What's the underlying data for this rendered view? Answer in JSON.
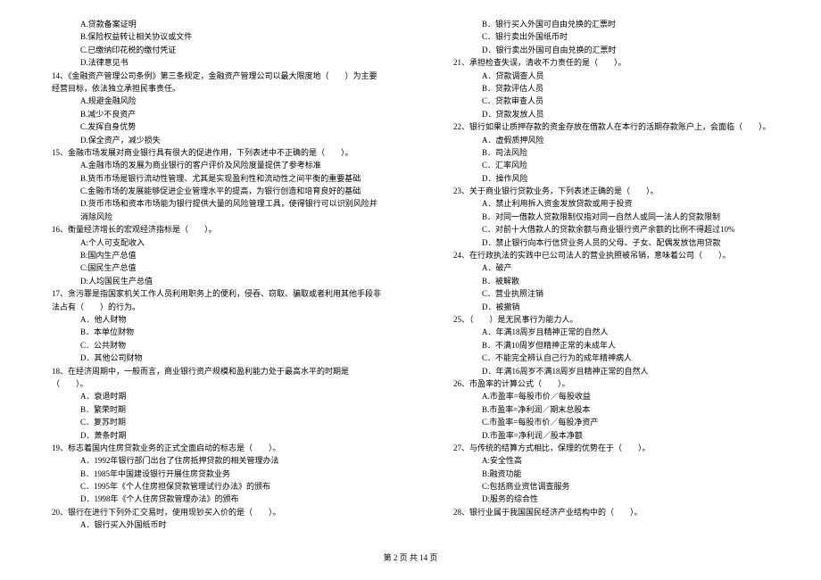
{
  "left": [
    {
      "cls": "option",
      "t": "A.贷款备案证明"
    },
    {
      "cls": "option",
      "t": "B.保险权益转让相关协议或文件"
    },
    {
      "cls": "option",
      "t": "C.已缴纳印花税的缴付凭证"
    },
    {
      "cls": "option",
      "t": "D.法律意见书"
    },
    {
      "cls": "question",
      "t": "14、《金融资产管理公司条例》第三条规定，金融资产管理公司以最大限度地（　　）为主要经营目标，依法独立承担民事责任。"
    },
    {
      "cls": "option",
      "t": "A.规避金融风险"
    },
    {
      "cls": "option",
      "t": "B.减少不良资产"
    },
    {
      "cls": "option",
      "t": "C.发挥自身优势"
    },
    {
      "cls": "option",
      "t": "D.保全资产，减少损失"
    },
    {
      "cls": "question",
      "t": "15、金融市场发展对商业银行具有很大的促进作用，下列表述中不正确的是（　　）。"
    },
    {
      "cls": "option",
      "t": "A.金融市场的发展为商业银行的客户评价及风险度量提供了参考标准"
    },
    {
      "cls": "option",
      "t": "B.货币市场是银行流动性管理、尤其是实现盈利性和流动性之间平衡的重要基础"
    },
    {
      "cls": "option",
      "t": "C.金融市场的发展能够促进企业管理水平的提高，为银行创造和培育良好的基础"
    },
    {
      "cls": "option",
      "t": "D.货币市场和资本市场能为银行提供大量的风险管理工具，使得银行可以识别风险并消除风险"
    },
    {
      "cls": "question",
      "t": "16、衡量经济增长的宏观经济指标是（　　）。"
    },
    {
      "cls": "option",
      "t": "A:个人可支配收入"
    },
    {
      "cls": "option",
      "t": "B:国内生产总值"
    },
    {
      "cls": "option",
      "t": "C:国民生产总值"
    },
    {
      "cls": "option",
      "t": "D:人均国民生产总值"
    },
    {
      "cls": "question",
      "t": "17、贪污罪是指国家机关工作人员利用职务上的便利，侵吞、窃取、骗取或者利用其他手段非法占有（　　）的行为。"
    },
    {
      "cls": "option",
      "t": "A．他人财物"
    },
    {
      "cls": "option",
      "t": "B．本单位财物"
    },
    {
      "cls": "option",
      "t": "C．公共财物"
    },
    {
      "cls": "option",
      "t": "D．其他公司财物"
    },
    {
      "cls": "question",
      "t": "18、在经济周期中，一般而言，商业银行资产规模和盈利能力处于最高水平的时期是（　　）。"
    },
    {
      "cls": "option",
      "t": "A．衰退时期"
    },
    {
      "cls": "option",
      "t": "B．繁荣时期"
    },
    {
      "cls": "option",
      "t": "C．复苏时期"
    },
    {
      "cls": "option",
      "t": "D．萧条时期"
    },
    {
      "cls": "question",
      "t": "19、标志着国内住房贷款业务的正式全面启动的标志是（　　）。"
    },
    {
      "cls": "option",
      "t": "A．1992年银行部门出台了住房抵押贷款的相关管理办法"
    },
    {
      "cls": "option",
      "t": "B．1985年中国建设银行开展住房贷款业务"
    },
    {
      "cls": "option",
      "t": "C．1995年《个人住房担保贷款管理试行办法》的颁布"
    },
    {
      "cls": "option",
      "t": "D．1998年《个人住房贷款管理办法》的颁布"
    },
    {
      "cls": "question",
      "t": "20、银行在进行下列外汇交易时，使用现钞买入价的是（　　）。"
    },
    {
      "cls": "option",
      "t": "A．银行买入外国纸币时"
    }
  ],
  "right": [
    {
      "cls": "option",
      "t": "B．银行买入外国可自由兑换的汇票时"
    },
    {
      "cls": "option",
      "t": "C．银行卖出外国纸币时"
    },
    {
      "cls": "option",
      "t": "D．银行卖出外国可自由兑换的汇票时"
    },
    {
      "cls": "question",
      "t": "21、承担检查失误，清收不力责任的是（　　）。"
    },
    {
      "cls": "option",
      "t": "A．贷款调查人员"
    },
    {
      "cls": "option",
      "t": "B．贷款评估人员"
    },
    {
      "cls": "option",
      "t": "C．贷款审查人员"
    },
    {
      "cls": "option",
      "t": "D．贷款发放人员"
    },
    {
      "cls": "question",
      "t": "22、银行如果让质押存款的资金存放在借款人在本行的活期存款账户上，会面临（　　）。"
    },
    {
      "cls": "option",
      "t": "A．虚假质押风险"
    },
    {
      "cls": "option",
      "t": "B．司法风险"
    },
    {
      "cls": "option",
      "t": "C．汇率风险"
    },
    {
      "cls": "option",
      "t": "D．操作风险"
    },
    {
      "cls": "question",
      "t": "23、关于商业银行贷款业务，下列表述正确的是（　　）。"
    },
    {
      "cls": "option",
      "t": "A．禁止利用拆入资金发放贷款或用于投资"
    },
    {
      "cls": "option",
      "t": "B．对同一借款人贷款限制仅指对同一自然人或同一法人的贷款限制"
    },
    {
      "cls": "option",
      "t": "C．对前十大借款人的贷款余额与商业银行资产余额的比例不得超过10%"
    },
    {
      "cls": "option",
      "t": "D．禁止银行向本行信贷业务人员的父母、子女、配偶发放信用贷款"
    },
    {
      "cls": "question",
      "t": "24、在行政执法的实践中已公司法人的营业执照被吊销，意味着公司（　　）。"
    },
    {
      "cls": "option",
      "t": "A．破产"
    },
    {
      "cls": "option",
      "t": "B．被解散"
    },
    {
      "cls": "option",
      "t": "C．营业执照注销"
    },
    {
      "cls": "option",
      "t": "D．被撤销"
    },
    {
      "cls": "question",
      "t": "25、（　　）是无民事行为能力人。"
    },
    {
      "cls": "option",
      "t": "A．年满18周岁且精神正常的自然人"
    },
    {
      "cls": "option",
      "t": "B．不满10周岁但精神正常的未成年人"
    },
    {
      "cls": "option",
      "t": "C．不能完全辨认自己行为的成年精神病人"
    },
    {
      "cls": "option",
      "t": "D．年满16周岁不满18周岁且精神正常的自然人"
    },
    {
      "cls": "question",
      "t": "26、市盈率的计算公式（　　）。"
    },
    {
      "cls": "option",
      "t": "A.市盈率=每股市价／每股收益"
    },
    {
      "cls": "option",
      "t": "B.市盈率=净利润／期末总股本"
    },
    {
      "cls": "option",
      "t": "C.市盈率=每股市价／每股净资产"
    },
    {
      "cls": "option",
      "t": "D.市盈率=净利润／股本净额"
    },
    {
      "cls": "question",
      "t": "27、与传统的结算方式相比，保理的优势在于（　　）。"
    },
    {
      "cls": "option",
      "t": "A:安全性高"
    },
    {
      "cls": "option",
      "t": "B:融资功能"
    },
    {
      "cls": "option",
      "t": "C:包括商业资信调查服务"
    },
    {
      "cls": "option",
      "t": "D:服务的综合性"
    },
    {
      "cls": "question",
      "t": "28、银行业属于我国国民经济产业结构中的（　　）。"
    }
  ],
  "footer": "第 2 页 共 14 页"
}
